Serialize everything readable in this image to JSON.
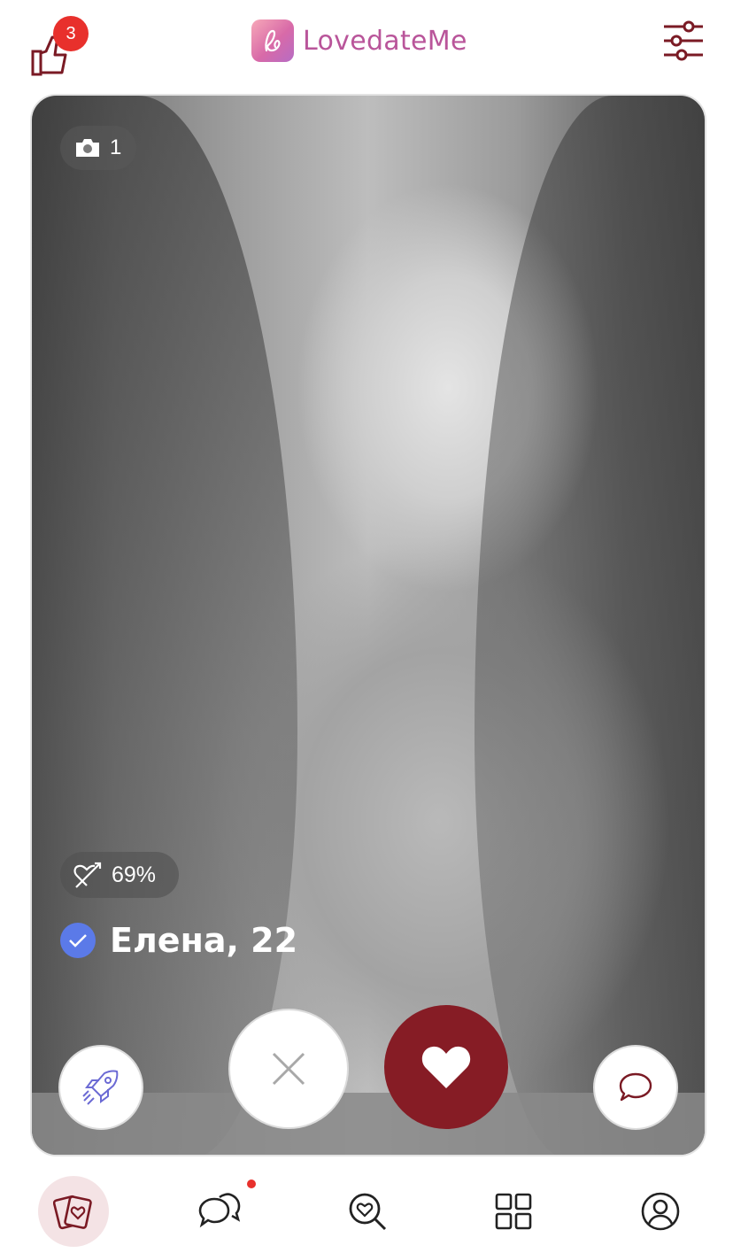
{
  "header": {
    "app_name": "LovedateMe",
    "likes_badge": "3",
    "icons": {
      "likes": "thumbs-up-icon",
      "filter": "sliders-icon"
    }
  },
  "profile": {
    "photo_count": "1",
    "match_percent": "69%",
    "name_age": "Елена, 22",
    "verified": true
  },
  "actions": {
    "icons": [
      "rocket-icon",
      "close-icon",
      "heart-icon",
      "chat-bubble-icon"
    ]
  },
  "bottom_nav": {
    "items": [
      {
        "icon": "cards-heart-icon",
        "active": true
      },
      {
        "icon": "chats-icon",
        "notification_dot": true
      },
      {
        "icon": "search-heart-icon"
      },
      {
        "icon": "grid-icon"
      },
      {
        "icon": "profile-icon"
      }
    ]
  },
  "colors": {
    "brand": "#b9559a",
    "like_button": "#861c25",
    "badge": "#e8302c",
    "verified": "#5b7ae8",
    "icon_dark": "#7a1a24",
    "active_nav_bg": "#f4e3e5"
  }
}
